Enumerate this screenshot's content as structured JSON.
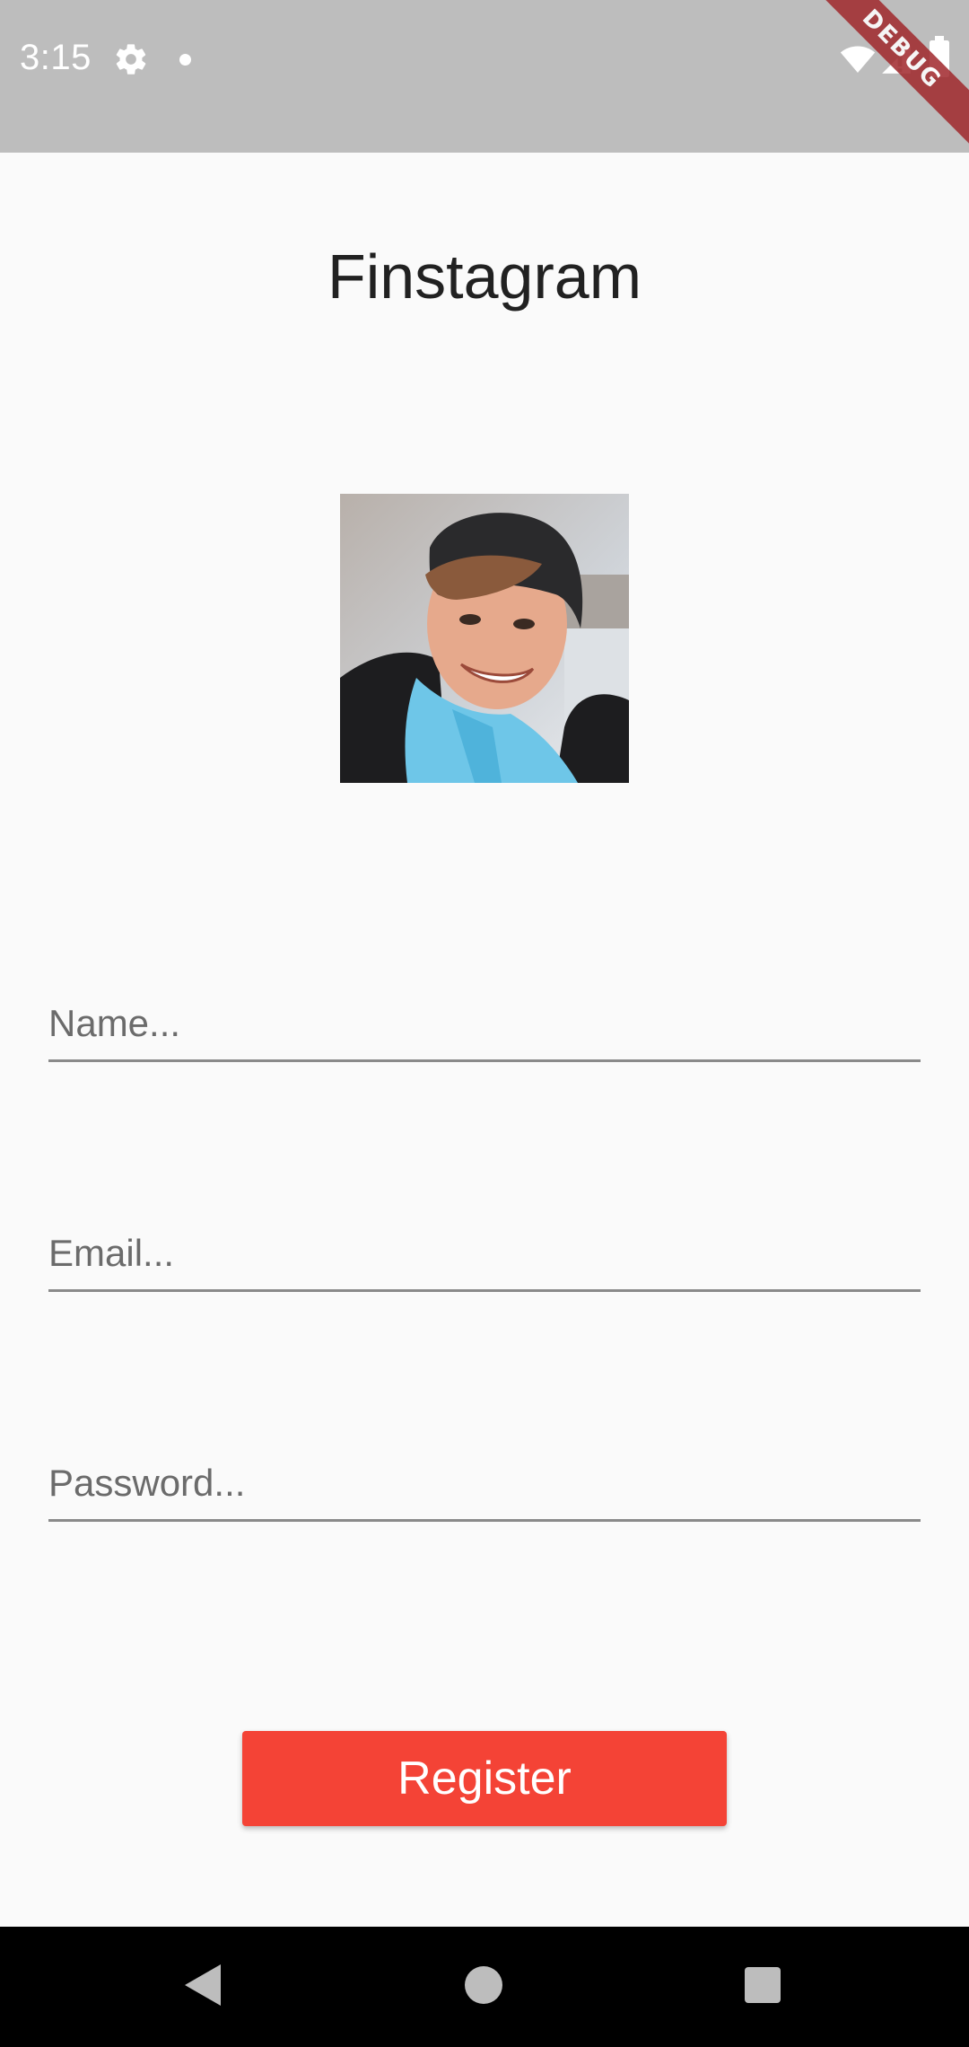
{
  "status_bar": {
    "time": "3:15",
    "icons": [
      "gear-icon",
      "notification-dot-icon",
      "wifi-icon",
      "signal-icon",
      "battery-icon"
    ],
    "background": "#bdbdbd"
  },
  "debug_banner": {
    "label": "DEBUG",
    "color": "#a0282c"
  },
  "header": {
    "title": "Finstagram"
  },
  "profile": {
    "avatar_icon": "profile-photo"
  },
  "form": {
    "name_placeholder": "Name...",
    "email_placeholder": "Email...",
    "password_placeholder": "Password...",
    "name_value": "",
    "email_value": "",
    "password_value": ""
  },
  "register": {
    "label": "Register",
    "color": "#f44336"
  },
  "nav_bar": {
    "icons": [
      "back-icon",
      "home-icon",
      "recents-icon"
    ]
  }
}
